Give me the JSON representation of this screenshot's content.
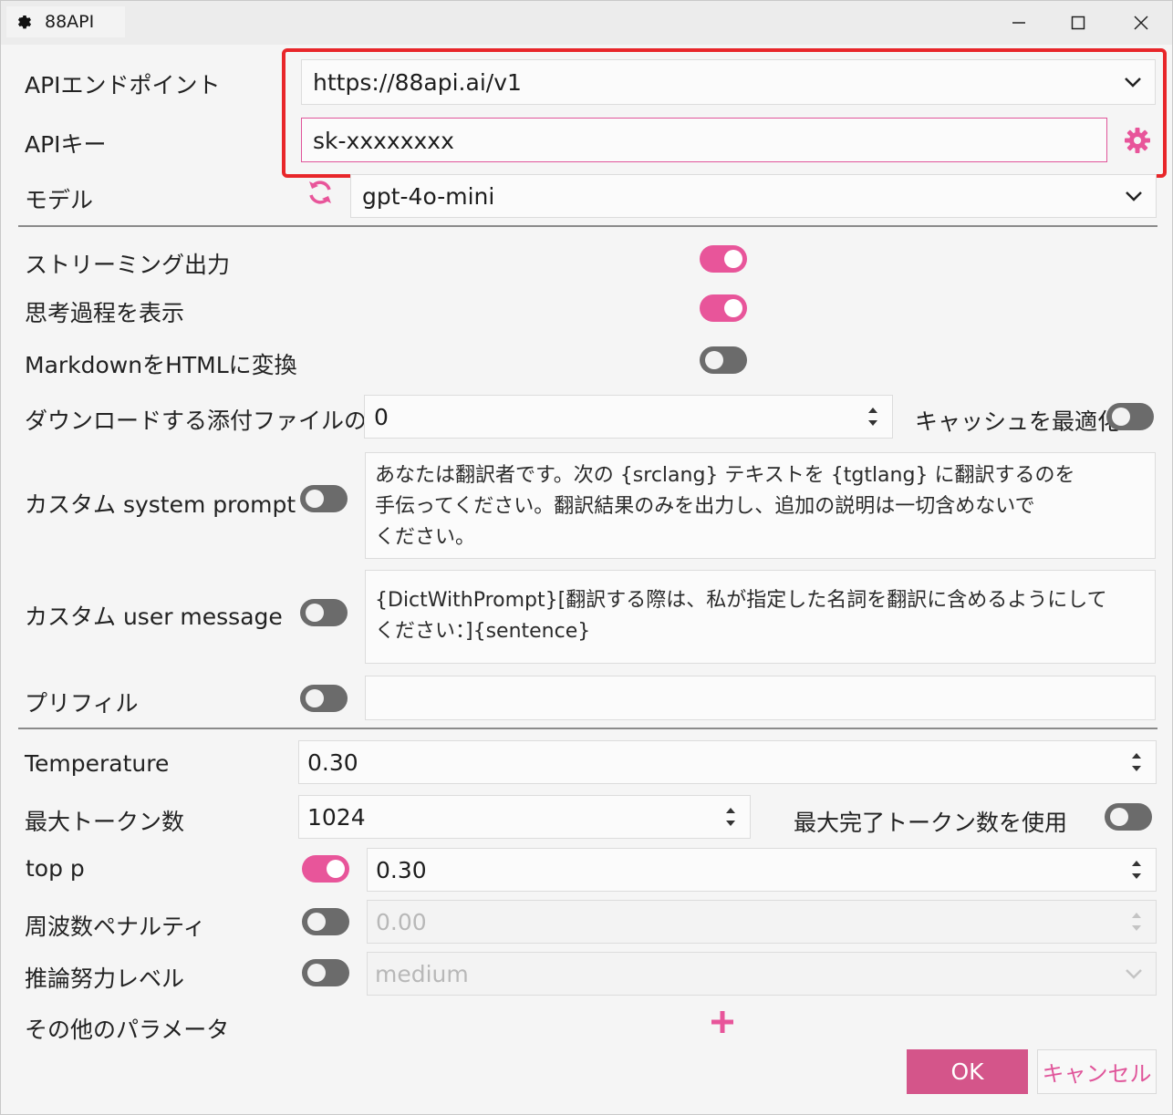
{
  "window": {
    "title": "88API"
  },
  "api": {
    "endpoint_label": "APIエンドポイント",
    "endpoint_value": "https://88api.ai/v1",
    "key_label": "APIキー",
    "key_value": "sk-xxxxxxxx",
    "model_label": "モデル",
    "model_value": "gpt-4o-mini"
  },
  "options": {
    "streaming_label": "ストリーミング出力",
    "thinking_label": "思考過程を表示",
    "markdown_label": "MarkdownをHTMLに変換",
    "attachments_label": "ダウンロードする添付ファイルの数",
    "attachments_value": "0",
    "cache_label": "キャッシュを最適化",
    "system_prompt_label": "カスタム system prompt",
    "system_prompt_value": "あなたは翻訳者です。次の {srclang} テキストを {tgtlang} に翻訳するのを\n手伝ってください。翻訳結果のみを出力し、追加の説明は一切含めないで\nください。",
    "user_message_label": "カスタム user message",
    "user_message_value": "{DictWithPrompt}[翻訳する際は、私が指定した名詞を翻訳に含めるようにして\nください：]{sentence}",
    "prefill_label": "プリフィル",
    "prefill_value": ""
  },
  "params": {
    "temperature_label": "Temperature",
    "temperature_value": "0.30",
    "max_tokens_label": "最大トークン数",
    "max_tokens_value": "1024",
    "max_completion_label": "最大完了トークン数を使用",
    "top_p_label": "top p",
    "top_p_value": "0.30",
    "freq_penalty_label": "周波数ペナルティ",
    "freq_penalty_value": "0.00",
    "reasoning_label": "推論努力レベル",
    "reasoning_value": "medium",
    "other_params_label": "その他のパラメータ"
  },
  "toggles": {
    "streaming": true,
    "thinking": true,
    "markdown": false,
    "cache": false,
    "system_prompt": false,
    "user_message": false,
    "prefill": false,
    "max_completion": false,
    "top_p": true,
    "freq_penalty": false,
    "reasoning": false
  },
  "buttons": {
    "ok": "OK",
    "cancel": "キャンセル"
  },
  "colors": {
    "accent": "#e8559a",
    "highlight_box": "#e8262a",
    "ok_bg": "#d4558a"
  },
  "icons": [
    "gear-icon",
    "minimize-icon",
    "maximize-icon",
    "close-icon",
    "chevron-down-icon",
    "settings-gear-icon",
    "refresh-icon",
    "spinner-arrows-icon",
    "plus-icon"
  ]
}
